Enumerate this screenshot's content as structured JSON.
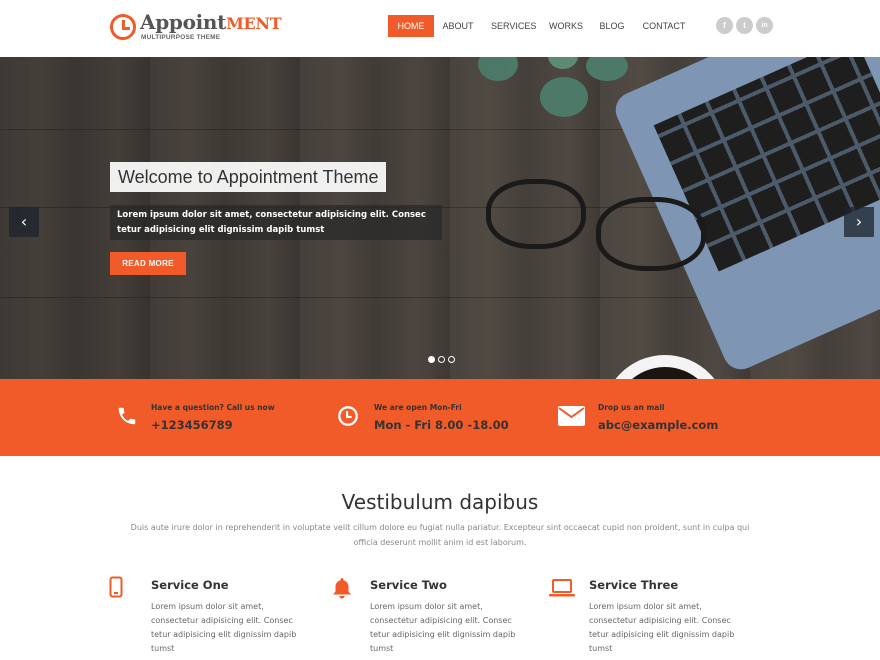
{
  "brand": {
    "name_part1": "Appoint",
    "name_part2": "ment",
    "tagline": "MULTIPURPOSE THEME"
  },
  "nav": {
    "items": [
      {
        "label": "HOME",
        "active": true
      },
      {
        "label": "ABOUT",
        "active": false
      },
      {
        "label": "SERVICES",
        "active": false
      },
      {
        "label": "WORKS",
        "active": false
      },
      {
        "label": "BLOG",
        "active": false
      },
      {
        "label": "CONTACT",
        "active": false
      }
    ]
  },
  "social": [
    {
      "icon": "facebook-icon",
      "glyph": "f"
    },
    {
      "icon": "twitter-icon",
      "glyph": "t"
    },
    {
      "icon": "linkedin-icon",
      "glyph": "in"
    }
  ],
  "hero": {
    "title": "Welcome to Appointment Theme",
    "text": "Lorem ipsum dolor sit amet, consectetur adipisicing elit. Consec tetur adipisicing elit dignissim dapib tumst",
    "button": "READ MORE",
    "prev_glyph": "‹",
    "next_glyph": "›",
    "slides_total": 3,
    "slide_active": 1
  },
  "infobar": [
    {
      "icon": "phone-icon",
      "sub": "Have a question? Call us now",
      "main": "+123456789"
    },
    {
      "icon": "clock-icon",
      "sub": "We are open Mon-Fri",
      "main": "Mon - Fri 8.00 -18.00"
    },
    {
      "icon": "mail-icon",
      "sub": "Drop us an mail",
      "main": "abc@example.com"
    }
  ],
  "services": {
    "title": "Vestibulum dapibus",
    "description": "Duis aute irure dolor in reprehenderit in voluptate velit cillum dolore eu fugiat nulla pariatur. Excepteur sint occaecat cupid non proident, sunt in culpa qui officia deserunt mollit anim id est laborum.",
    "items": [
      {
        "icon": "mobile-icon",
        "title": "Service One",
        "text": "Lorem ipsum dolor sit amet, consectetur adipisicing elit. Consec tetur adipisicing elit dignissim dapib tumst"
      },
      {
        "icon": "bell-icon",
        "title": "Service Two",
        "text": "Lorem ipsum dolor sit amet, consectetur adipisicing elit. Consec tetur adipisicing elit dignissim dapib tumst"
      },
      {
        "icon": "laptop-icon",
        "title": "Service Three",
        "text": "Lorem ipsum dolor sit amet, consectetur adipisicing elit. Consec tetur adipisicing elit dignissim dapib tumst"
      }
    ]
  },
  "colors": {
    "accent": "#f15b2a",
    "text": "#333333",
    "muted": "#888888"
  }
}
